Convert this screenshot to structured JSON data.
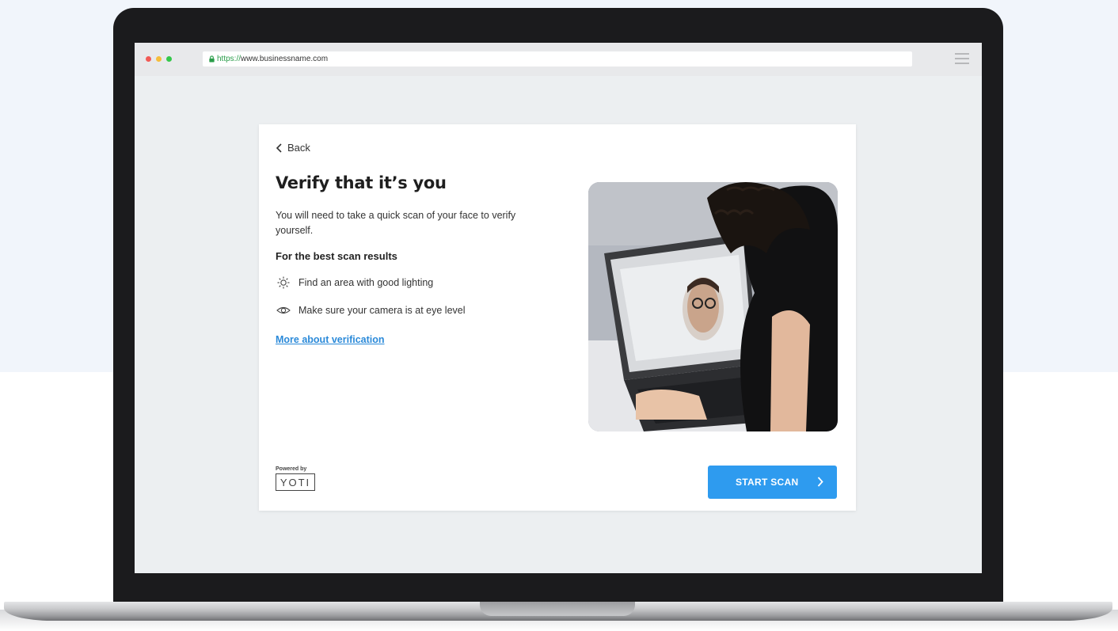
{
  "browser": {
    "url_scheme": "https://",
    "url_host": "www.businessname.com"
  },
  "card": {
    "back_label": "Back",
    "title": "Verify that it’s you",
    "description": "You will need to take a quick scan of your face to verify yourself.",
    "subheading": "For the best scan results",
    "tips": [
      {
        "icon": "sun-icon",
        "text": "Find an area with good lighting"
      },
      {
        "icon": "eye-icon",
        "text": "Make sure your camera is at eye level"
      }
    ],
    "more_link": "More about verification",
    "powered_by": "Powered by",
    "brand": "YOTI",
    "start_button": "START SCAN"
  },
  "colors": {
    "accent": "#2e9bef",
    "link": "#2b8ad9",
    "page_bg": "#f1f5fb",
    "screen_bg": "#eceff1"
  }
}
